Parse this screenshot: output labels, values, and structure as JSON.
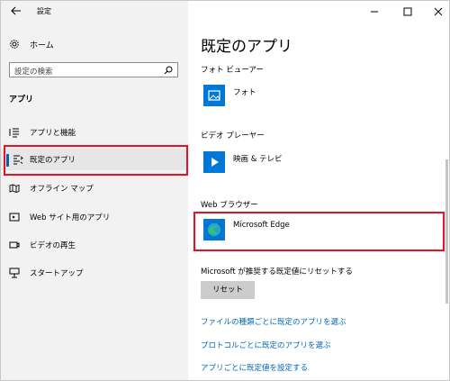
{
  "window": {
    "title": "設定"
  },
  "sidebar": {
    "home_label": "ホーム",
    "search_placeholder": "設定の検索",
    "section_title": "アプリ",
    "items": [
      {
        "label": "アプリと機能",
        "icon": "list-icon"
      },
      {
        "label": "既定のアプリ",
        "icon": "default-apps-icon",
        "selected": true
      },
      {
        "label": "オフライン マップ",
        "icon": "offline-map-icon"
      },
      {
        "label": "Web サイト用のアプリ",
        "icon": "web-apps-icon"
      },
      {
        "label": "ビデオの再生",
        "icon": "video-icon"
      },
      {
        "label": "スタートアップ",
        "icon": "startup-icon"
      }
    ]
  },
  "main": {
    "title": "既定のアプリ",
    "categories": [
      {
        "label": "フォト ビューアー",
        "app": "フォト",
        "icon": "photos-icon"
      },
      {
        "label": "ビデオ プレーヤー",
        "app": "映画 & テレビ",
        "icon": "movies-tv-icon"
      },
      {
        "label": "Web ブラウザー",
        "app": "Microsoft Edge",
        "icon": "edge-icon"
      }
    ],
    "reset_text": "Microsoft が推奨する既定値にリセットする",
    "reset_button": "リセット",
    "links": [
      "ファイルの種類ごとに既定のアプリを選ぶ",
      "プロトコルごとに既定のアプリを選ぶ",
      "アプリごとに既定値を設定する"
    ]
  },
  "colors": {
    "accent": "#0078d7",
    "highlight": "#e81123",
    "link": "#0066b4",
    "sidebar_bg": "#f2f2f2"
  }
}
